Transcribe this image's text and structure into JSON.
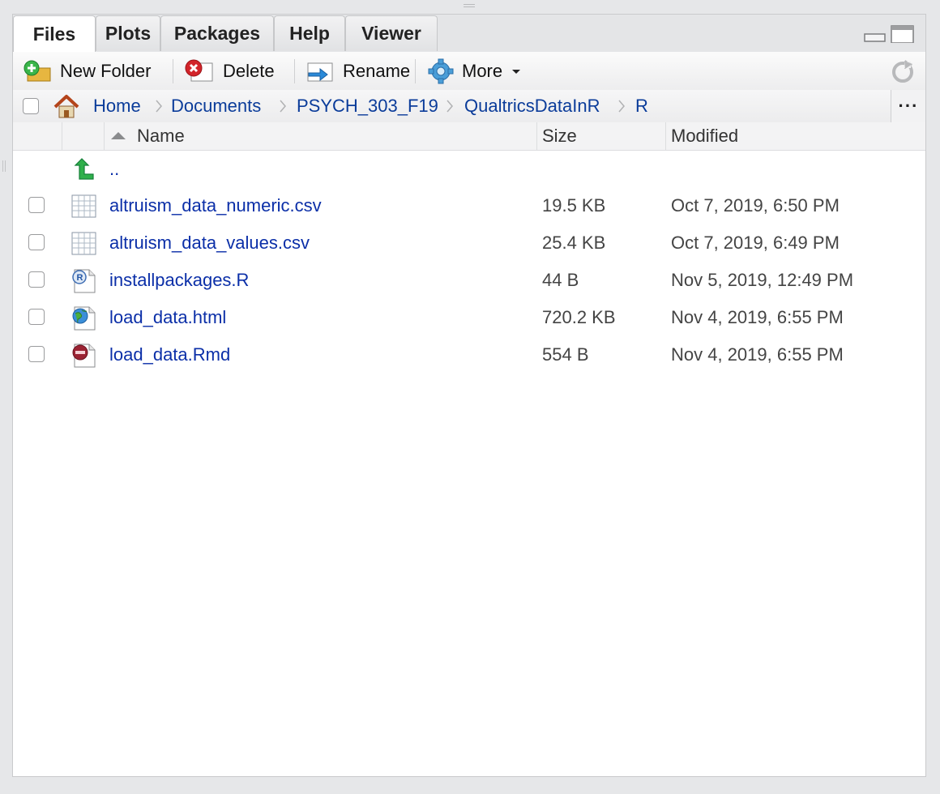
{
  "tabs": [
    {
      "label": "Files",
      "active": true
    },
    {
      "label": "Plots",
      "active": false
    },
    {
      "label": "Packages",
      "active": false
    },
    {
      "label": "Help",
      "active": false
    },
    {
      "label": "Viewer",
      "active": false
    }
  ],
  "toolbar": {
    "new_folder": "New Folder",
    "delete": "Delete",
    "rename": "Rename",
    "more": "More"
  },
  "breadcrumb": {
    "items": [
      "Home",
      "Documents",
      "PSYCH_303_F19",
      "QualtricsDataInR",
      "R"
    ],
    "overflow": "···"
  },
  "columns": {
    "name": "Name",
    "size": "Size",
    "modified": "Modified",
    "sort": "ascending"
  },
  "parent_dir": "..",
  "files": [
    {
      "name": "altruism_data_numeric.csv",
      "size": "19.5 KB",
      "modified": "Oct 7, 2019, 6:50 PM",
      "icon": "csv-file-icon"
    },
    {
      "name": "altruism_data_values.csv",
      "size": "25.4 KB",
      "modified": "Oct 7, 2019, 6:49 PM",
      "icon": "csv-file-icon"
    },
    {
      "name": "installpackages.R",
      "size": "44 B",
      "modified": "Nov 5, 2019, 12:49 PM",
      "icon": "r-script-icon"
    },
    {
      "name": "load_data.html",
      "size": "720.2 KB",
      "modified": "Nov 4, 2019, 6:55 PM",
      "icon": "html-file-icon"
    },
    {
      "name": "load_data.Rmd",
      "size": "554 B",
      "modified": "Nov 4, 2019, 6:55 PM",
      "icon": "rmd-file-icon"
    }
  ],
  "colors": {
    "link": "#0b2fa8",
    "breadcrumb": "#0b3c9a",
    "pane_bg": "#e6e7e9"
  }
}
